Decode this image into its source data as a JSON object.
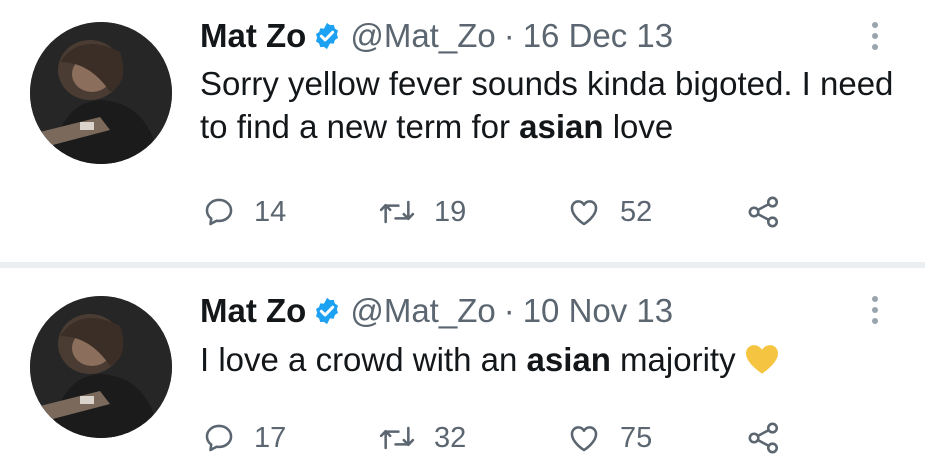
{
  "tweets": [
    {
      "name": "Mat Zo",
      "handle": "@Mat_Zo",
      "separator": "·",
      "date": "16 Dec 13",
      "text_parts": [
        "Sorry yellow fever sounds kinda bigoted. I need to find a new term for ",
        "asian",
        " love"
      ],
      "replies": "14",
      "retweets": "19",
      "likes": "52"
    },
    {
      "name": "Mat Zo",
      "handle": "@Mat_Zo",
      "separator": "·",
      "date": "10 Nov 13",
      "text_parts": [
        "I love a crowd with an ",
        "asian",
        " majority"
      ],
      "emoji": "yellow-heart",
      "replies": "17",
      "retweets": "32",
      "likes": "75"
    }
  ],
  "colors": {
    "verified": "#1da1f2",
    "muted": "#5b6670",
    "heart_emoji": "#f5c542"
  },
  "icons": [
    "reply-icon",
    "retweet-icon",
    "like-icon",
    "share-icon",
    "more-icon",
    "verified-badge-icon"
  ]
}
